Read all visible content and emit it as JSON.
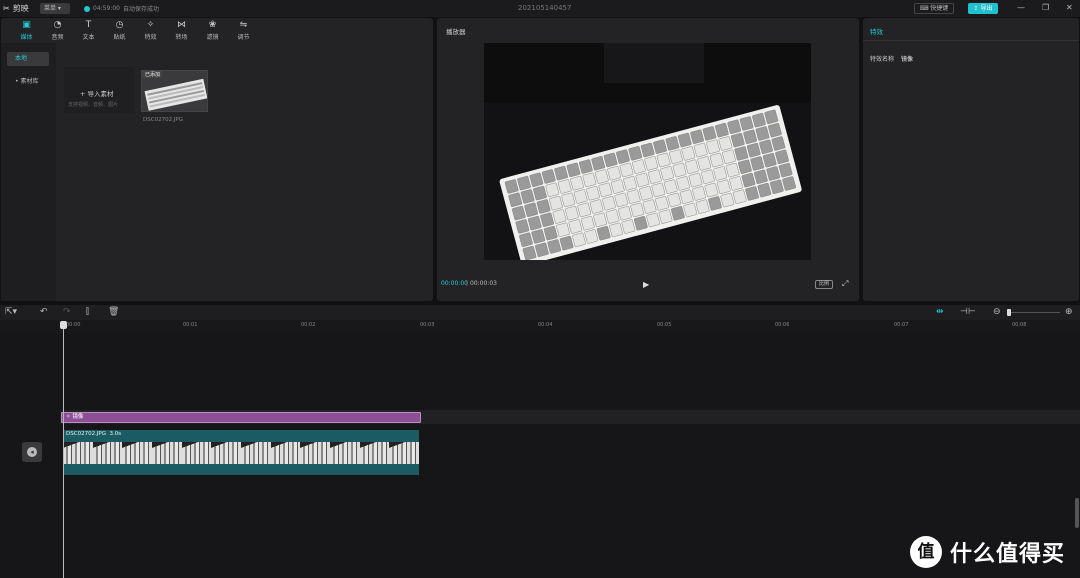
{
  "titlebar": {
    "app_name": "剪映",
    "menu_label": "菜单",
    "save_time": "04:59:00",
    "save_status": "自动保存成功",
    "project_name": "202105140457",
    "shortcut_label": "快捷键",
    "export_label": "导出"
  },
  "media_toolbar": {
    "tabs": [
      {
        "label": "媒体",
        "icon": "media-icon",
        "active": true
      },
      {
        "label": "音频",
        "icon": "audio-icon"
      },
      {
        "label": "文本",
        "icon": "text-icon"
      },
      {
        "label": "贴纸",
        "icon": "sticker-icon"
      },
      {
        "label": "特效",
        "icon": "effects-icon"
      },
      {
        "label": "转场",
        "icon": "transition-icon"
      },
      {
        "label": "滤镜",
        "icon": "filter-icon"
      },
      {
        "label": "调节",
        "icon": "adjust-icon"
      }
    ]
  },
  "sidebar": {
    "items": [
      {
        "label": "本地",
        "selected": true
      },
      {
        "label": "素材库"
      }
    ]
  },
  "media": {
    "import_label": "导入素材",
    "import_hint": "支持视频、音频、图片",
    "added_badge": "已添加",
    "file_name": "DSC02702.JPG"
  },
  "player": {
    "title": "播放器",
    "current_time": "00:00:00",
    "separator": "|",
    "total_time": "00:00:03",
    "ratio_label": "比例"
  },
  "attributes": {
    "title": "特效",
    "label": "特效名称",
    "value": "镜像"
  },
  "timeline": {
    "ruler": [
      "00:00",
      "00:01",
      "00:02",
      "00:03",
      "00:04",
      "00:05",
      "00:06",
      "00:07",
      "00:08"
    ],
    "effect_clip": "镜像",
    "video_clip_name": "DSC02702.JPG",
    "video_clip_duration": "3.0s"
  },
  "watermark": {
    "logo": "值",
    "text": "什么值得买"
  },
  "colors": {
    "accent": "#22c9d6",
    "effect_clip": "#8c4e94",
    "video_clip": "#1b5b63"
  }
}
